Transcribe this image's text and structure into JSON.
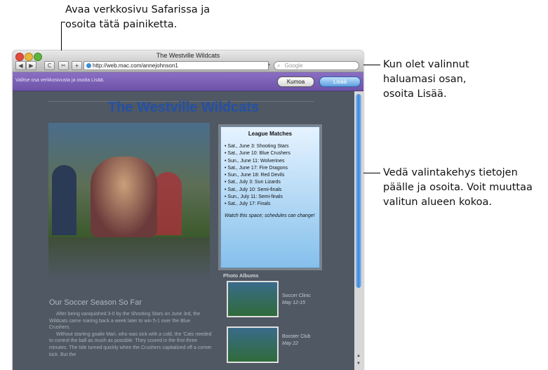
{
  "callouts": {
    "top": [
      "Avaa verkkosivu Safarissa ja",
      "osoita tätä painiketta."
    ],
    "add": [
      "Kun olet valinnut",
      "haluamasi osan,",
      "osoita Lisää."
    ],
    "frame": [
      "Vedä valintakehys tietojen",
      "päälle ja osoita. Voit muuttaa",
      "valitun alueen kokoa."
    ]
  },
  "window": {
    "title": "The Westville Wildcats",
    "url": "http://web.mac.com/annejohnson1",
    "search_placeholder": "Google",
    "toolbar": {
      "back": "◀",
      "forward": "▶",
      "reload": "C",
      "webclip": "✂",
      "add": "+"
    }
  },
  "webclip_bar": {
    "instruction": "Valitse osa verkkosivusta ja osoita Lisää.",
    "cancel_label": "Kumoa",
    "add_label": "Lisää"
  },
  "page": {
    "site_title": "The Westville Wildcats",
    "league": {
      "title": "League Matches",
      "items": [
        "• Sat., June 3: Shooting Stars",
        "• Sat., June 10: Blue Crushers",
        "• Sun., June 11: Wolverines",
        "• Sat., June 17: Fire Dragons",
        "• Sun., June 18: Red Devils",
        "• Sat., July 3: Sun Lizards",
        "• Sat., July 10: Semi-finals",
        "• Sun., July 11: Semi-finals",
        "• Sat., July 17: Finals"
      ],
      "note": "Watch this space; schedules can change!"
    },
    "albums": {
      "heading": "Photo Albums",
      "items": [
        {
          "title": "Soccer Clinic",
          "date": "May 12-15"
        },
        {
          "title": "Booster Club",
          "date": "May 22"
        }
      ]
    },
    "article": {
      "heading": "Our Soccer Season So Far",
      "p1": "After being vanquished 3-0 by the Shooting Stars on June 3rd, the Wildcats came roaring back a week later to win 5-1 over the Blue Crushers.",
      "p2": "Without starting goalie Mari, who was sick with a cold, the 'Cats needed to control the ball as much as possible. They scored in the first three minutes. The tide turned quickly when the Crushers capitalized off a corner kick. But the"
    }
  },
  "colors": {
    "webclip_bar": "#7a5fb6",
    "site_title": "#2450a6",
    "selection": "#9fd0f3"
  }
}
